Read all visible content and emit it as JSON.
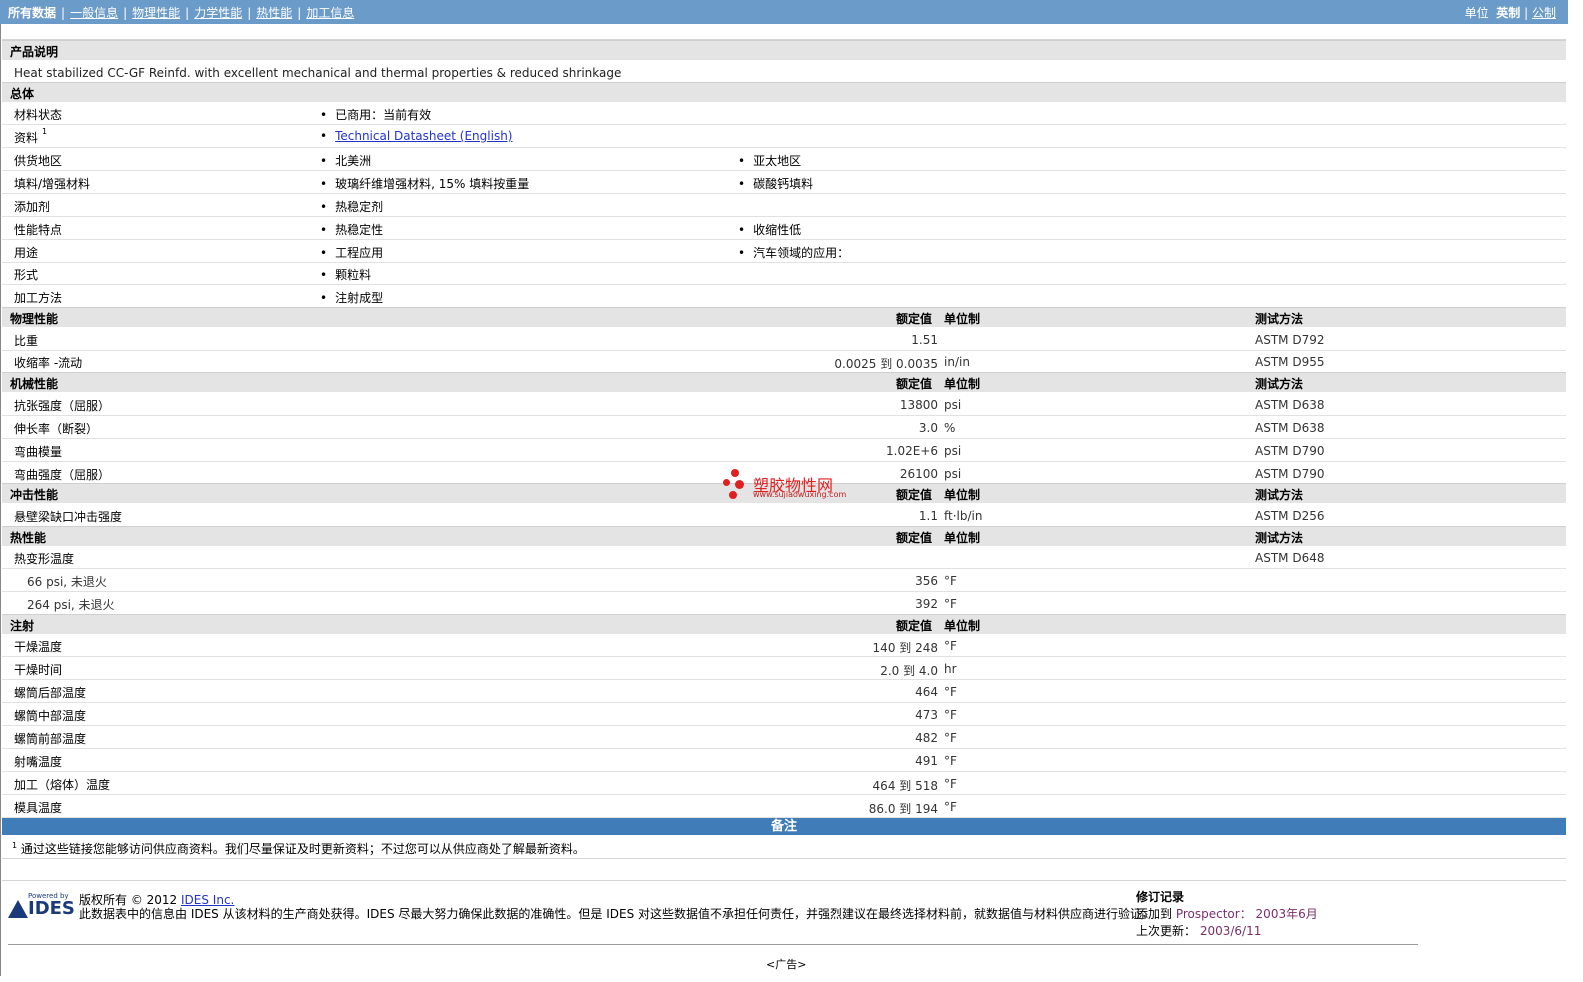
{
  "nav": {
    "items": [
      "所有数据",
      "一般信息",
      "物理性能",
      "力学性能",
      "热性能",
      "加工信息"
    ],
    "units_label": "单位",
    "unit_english": "英制",
    "unit_metric": "公制"
  },
  "product": {
    "section_title": "产品说明",
    "description": "Heat stabilized CC-GF Reinfd. with excellent mechanical and thermal properties & reduced shrinkage"
  },
  "general": {
    "section_title": "总体",
    "rows": [
      {
        "label": "材料状态",
        "b1": "已商用：当前有效",
        "b2": ""
      },
      {
        "label": "资料",
        "sup": "1",
        "link": "Technical Datasheet (English)",
        "b2": ""
      },
      {
        "label": "供货地区",
        "b1": "北美洲",
        "b2": "亚太地区"
      },
      {
        "label": "填料/增强材料",
        "b1": "玻璃纤维增强材料, 15% 填料按重量",
        "b2": "碳酸钙填料"
      },
      {
        "label": "添加剂",
        "b1": "热稳定剂",
        "b2": ""
      },
      {
        "label": "性能特点",
        "b1": "热稳定性",
        "b2": "收缩性低"
      },
      {
        "label": "用途",
        "b1": "工程应用",
        "b2": "汽车领域的应用："
      },
      {
        "label": "形式",
        "b1": "颗粒料",
        "b2": ""
      },
      {
        "label": "加工方法",
        "b1": "注射成型",
        "b2": ""
      }
    ]
  },
  "headers": {
    "value": "额定值",
    "unit": "单位制",
    "method": "测试方法"
  },
  "physical": {
    "section_title": "物理性能",
    "rows": [
      {
        "label": "比重",
        "value": "1.51",
        "unit": "",
        "method": "ASTM D792"
      },
      {
        "label": "收缩率 -流动",
        "value": "0.0025 到  0.0035",
        "unit": "in/in",
        "method": "ASTM D955"
      }
    ]
  },
  "mechanical": {
    "section_title": "机械性能",
    "rows": [
      {
        "label": "抗张强度（屈服）",
        "value": "13800",
        "unit": "psi",
        "method": "ASTM D638"
      },
      {
        "label": "伸长率（断裂）",
        "value": "3.0",
        "unit": "%",
        "method": "ASTM D638"
      },
      {
        "label": "弯曲模量",
        "value": "1.02E+6",
        "unit": "psi",
        "method": "ASTM D790"
      },
      {
        "label": "弯曲强度（屈服）",
        "value": "26100",
        "unit": "psi",
        "method": "ASTM D790"
      }
    ]
  },
  "impact": {
    "section_title": "冲击性能",
    "rows": [
      {
        "label": "悬壁梁缺口冲击强度",
        "value": "1.1",
        "unit": "ft·lb/in",
        "method": "ASTM D256"
      }
    ]
  },
  "thermal": {
    "section_title": "热性能",
    "rows": [
      {
        "label": "热变形温度",
        "value": "",
        "unit": "",
        "method": "ASTM D648"
      },
      {
        "label": "66 psi, 未退火",
        "value": "356",
        "unit": "°F",
        "method": "",
        "indent": true
      },
      {
        "label": "264 psi, 未退火",
        "value": "392",
        "unit": "°F",
        "method": "",
        "indent": true
      }
    ]
  },
  "injection": {
    "section_title": "注射",
    "rows": [
      {
        "label": "干燥温度",
        "value": "140 到  248",
        "unit": "°F"
      },
      {
        "label": "干燥时间",
        "value": "2.0 到  4.0",
        "unit": "hr"
      },
      {
        "label": "螺筒后部温度",
        "value": "464",
        "unit": "°F"
      },
      {
        "label": "螺筒中部温度",
        "value": "473",
        "unit": "°F"
      },
      {
        "label": "螺筒前部温度",
        "value": "482",
        "unit": "°F"
      },
      {
        "label": "射嘴温度",
        "value": "491",
        "unit": "°F"
      },
      {
        "label": "加工（熔体）温度",
        "value": "464 到  518",
        "unit": "°F"
      },
      {
        "label": "模具温度",
        "value": "86.0 到  194",
        "unit": "°F"
      }
    ]
  },
  "notes": {
    "title": "备注",
    "footnote_mark": "1",
    "footnote": "通过这些链接您能够访问供应商资料。我们尽量保证及时更新资料；不过您可以从供应商处了解最新资料。"
  },
  "footer": {
    "logo_powered": "Powered by",
    "logo_name": "IDES",
    "copyright_prefix": "版权所有 © 2012",
    "copyright_link": "IDES Inc.",
    "disclaimer": "此数据表中的信息由 IDES 从该材料的生产商处获得。IDES 尽最大努力确保此数据的准确性。但是 IDES 对这些数据值不承担任何责任，并强烈建议在最终选择材料前，就数据值与材料供应商进行验证。",
    "revision_title": "修订记录",
    "added_label": "添加到",
    "added_product": "Prospector：",
    "added_date": "2003年6月",
    "updated_label": "上次更新：",
    "updated_date": "2003/6/11"
  },
  "watermark": {
    "cn": "塑胶物性网",
    "en": "www.sujiaowuxing.com"
  },
  "ad": "<广告>"
}
